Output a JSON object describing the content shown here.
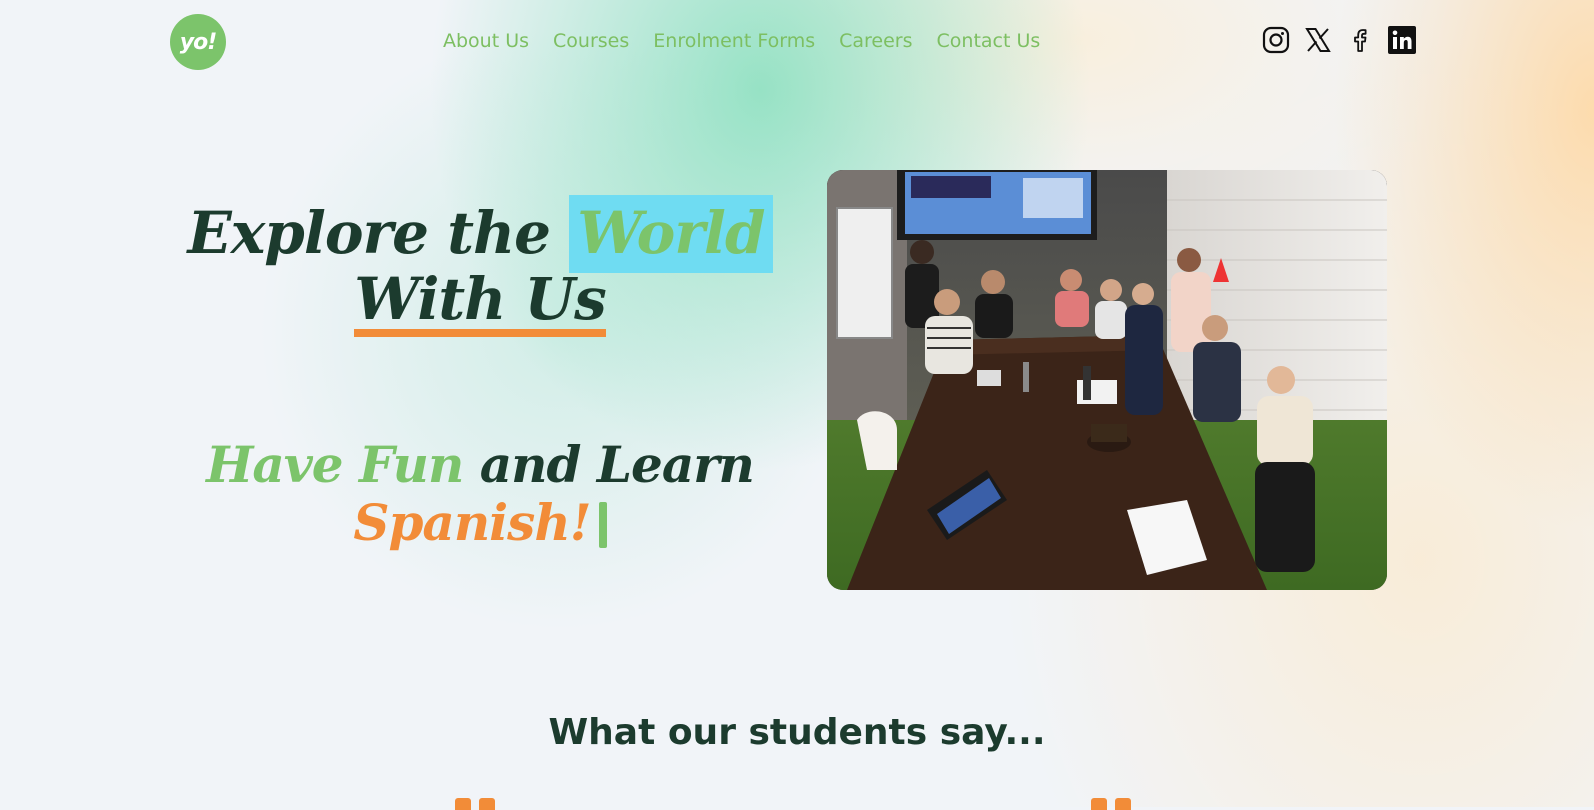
{
  "brand": {
    "logo_text": "yo!",
    "colors": {
      "green": "#7cc46b",
      "dark": "#1c3b2e",
      "orange": "#f28c38",
      "cyan_highlight": "#6fdcf2",
      "nav_green": "#7dbf62"
    }
  },
  "nav": {
    "items": [
      {
        "label": "About Us"
      },
      {
        "label": "Courses"
      },
      {
        "label": "Enrolment Forms"
      },
      {
        "label": "Careers"
      },
      {
        "label": "Contact Us"
      }
    ]
  },
  "social": {
    "icons": [
      "instagram-icon",
      "x-icon",
      "facebook-icon",
      "linkedin-icon"
    ]
  },
  "hero": {
    "headline_part1": "Explore the",
    "headline_highlight": "World",
    "headline_line2": "With Us",
    "tagline_green": "Have Fun",
    "tagline_dark": "and Learn",
    "tagline_orange": "Spanish!"
  },
  "testimonials": {
    "title": "What our students say..."
  }
}
